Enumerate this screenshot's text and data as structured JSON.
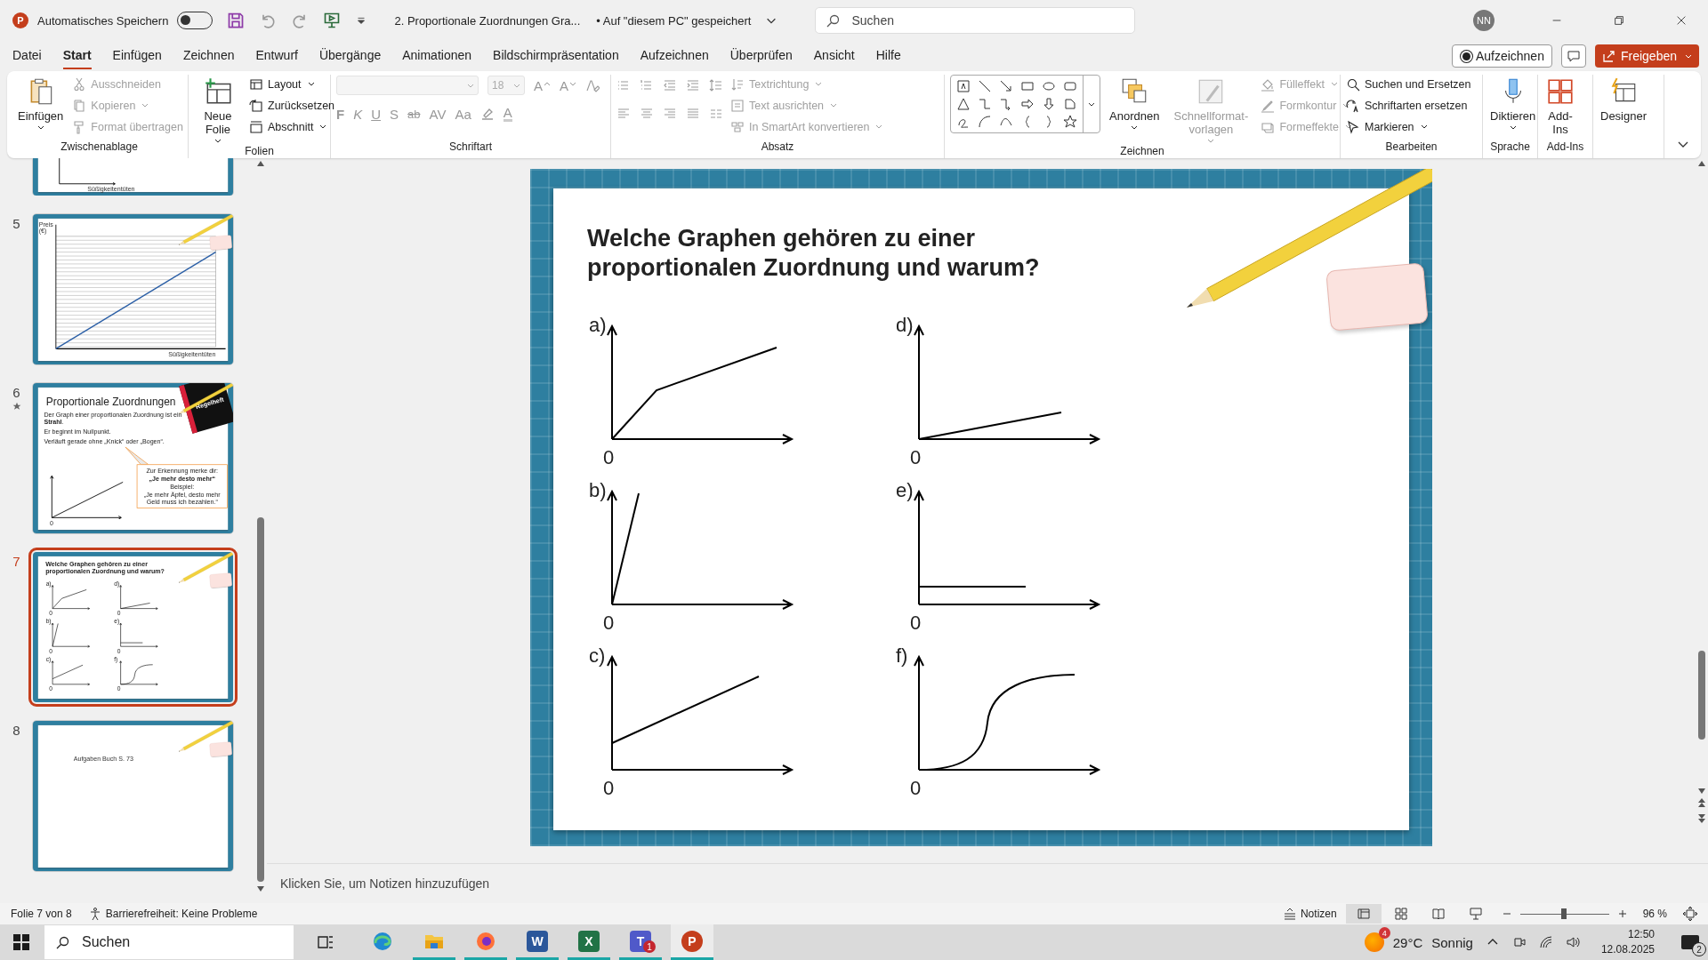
{
  "titlebar": {
    "app_letter": "P",
    "autosave": {
      "label": "Automatisches Speichern",
      "on": false
    },
    "document": "2. Proportionale Zuordnungen Gra...",
    "save_state": "• Auf \"diesem PC\" gespeichert",
    "search": {
      "placeholder": "Suchen"
    },
    "avatar": "NN"
  },
  "menu": [
    {
      "label": "Datei",
      "selected": false
    },
    {
      "label": "Start",
      "selected": true
    },
    {
      "label": "Einfügen",
      "selected": false
    },
    {
      "label": "Zeichnen",
      "selected": false
    },
    {
      "label": "Entwurf",
      "selected": false
    },
    {
      "label": "Übergänge",
      "selected": false
    },
    {
      "label": "Animationen",
      "selected": false
    },
    {
      "label": "Bildschirmpräsentation",
      "selected": false
    },
    {
      "label": "Aufzeichnen",
      "selected": false
    },
    {
      "label": "Überprüfen",
      "selected": false
    },
    {
      "label": "Ansicht",
      "selected": false
    },
    {
      "label": "Hilfe",
      "selected": false
    }
  ],
  "menu_actions": {
    "record": "Aufzeichnen",
    "share": "Freigeben"
  },
  "ribbon": {
    "clipboard": {
      "label": "Zwischenablage",
      "paste": "Einfügen",
      "items": [
        {
          "label": "Ausschneiden",
          "disabled": true
        },
        {
          "label": "Kopieren",
          "disabled": true
        },
        {
          "label": "Format übertragen",
          "disabled": true
        }
      ]
    },
    "slides": {
      "label": "Folien",
      "new_slide": "Neue Folie",
      "items": [
        {
          "label": "Layout",
          "disabled": false
        },
        {
          "label": "Zurücksetzen",
          "disabled": false
        },
        {
          "label": "Abschnitt",
          "disabled": false
        }
      ]
    },
    "font": {
      "label": "Schriftart",
      "size": "18",
      "grow": "A",
      "shrink": "A",
      "format_buttons": [
        "F",
        "K",
        "U",
        "S",
        "ab",
        "AV",
        "Aa"
      ],
      "font_color_button": "A"
    },
    "paragraph": {
      "label": "Absatz",
      "items": [
        {
          "label": "Textrichtung",
          "disabled": true
        },
        {
          "label": "Text ausrichten",
          "disabled": true
        },
        {
          "label": "In SmartArt konvertieren",
          "disabled": true
        }
      ]
    },
    "drawing": {
      "label": "Zeichnen",
      "arrange": "Anordnen",
      "quick_styles": "Schnellformat-vorlagen",
      "items": [
        {
          "label": "Fülleffekt",
          "disabled": true
        },
        {
          "label": "Formkontur",
          "disabled": true
        },
        {
          "label": "Formeffekte",
          "disabled": true
        }
      ]
    },
    "editing": {
      "label": "Bearbeiten",
      "items": [
        {
          "label": "Suchen und Ersetzen",
          "disabled": false
        },
        {
          "label": "Schriftarten ersetzen",
          "disabled": false
        },
        {
          "label": "Markieren",
          "disabled": false
        }
      ]
    },
    "voice": {
      "label": "Sprache",
      "dictate": "Diktieren"
    },
    "addins": {
      "label": "Add-Ins",
      "button": "Add-Ins"
    },
    "designer": {
      "button": "Designer"
    }
  },
  "thumbnails": [
    {
      "kind": "partial",
      "selected": false,
      "animated": false,
      "xlabel": "Süßigkeitentüten"
    },
    {
      "kind": "chart",
      "number": "5",
      "selected": false,
      "animated": false,
      "ylabel": "Preis (€)",
      "xlabel": "Süßigkeitentüten"
    },
    {
      "kind": "rule",
      "number": "6",
      "selected": false,
      "animated": true,
      "title": "Proportionale Zuordnungen",
      "book": "Regelheft",
      "lines": [
        "Der Graph einer proportionalen Zuordnung ist ein **Strahl**.",
        "Er beginnt im Nullpunkt.",
        "Verläuft gerade ohne „Knick“ oder „Bogen“."
      ],
      "callout": [
        "Zur Erkennung merke dir:",
        "**„Je mehr desto mehr“**",
        "Beispiel:",
        "„Je mehr Äpfel, desto mehr Geld muss ich bezahlen.“"
      ],
      "origin": "0"
    },
    {
      "kind": "graphs",
      "number": "7",
      "selected": true,
      "animated": false,
      "title": "Welche Graphen gehören zu einer proportionalen Zuordnung und warum?",
      "graphs": [
        {
          "label": "a)",
          "kind": "kinked",
          "origin": "0"
        },
        {
          "label": "d)",
          "kind": "shallow",
          "origin": "0"
        },
        {
          "label": "b)",
          "kind": "steep",
          "origin": "0"
        },
        {
          "label": "e)",
          "kind": "constant",
          "origin": "0"
        },
        {
          "label": "c)",
          "kind": "offset",
          "origin": "0"
        },
        {
          "label": "f)",
          "kind": "s-curve",
          "origin": "0"
        }
      ]
    },
    {
      "kind": "task",
      "number": "8",
      "selected": false,
      "animated": false,
      "text": "Aufgaben Buch S. 73"
    }
  ],
  "slide": {
    "title": "Welche Graphen gehören zu einer proportionalen Zuordnung und warum?",
    "graphs": [
      {
        "label": "a)",
        "kind": "kinked",
        "origin": "0"
      },
      {
        "label": "d)",
        "kind": "shallow",
        "origin": "0"
      },
      {
        "label": "b)",
        "kind": "steep",
        "origin": "0"
      },
      {
        "label": "e)",
        "kind": "constant",
        "origin": "0"
      },
      {
        "label": "c)",
        "kind": "offset",
        "origin": "0"
      },
      {
        "label": "f)",
        "kind": "s-curve",
        "origin": "0"
      }
    ]
  },
  "notes": {
    "placeholder": "Klicken Sie, um Notizen hinzuzufügen"
  },
  "status_bar": {
    "slide": "Folie 7 von 8",
    "accessibility": "Barrierefreiheit: Keine Probleme",
    "notes": "Notizen",
    "views": [
      {
        "selected": true
      },
      {
        "selected": false
      },
      {
        "selected": false
      },
      {
        "selected": false
      }
    ],
    "zoom": {
      "level": 0.49
    },
    "zoom_text": "96 %"
  },
  "taskbar": {
    "search": {
      "placeholder": "Suchen"
    },
    "apps": [
      {
        "running": false,
        "selected": false
      },
      {
        "running": true,
        "selected": false
      },
      {
        "running": true,
        "selected": false
      },
      {
        "letter": "W",
        "running": true,
        "selected": false
      },
      {
        "letter": "X",
        "running": true,
        "selected": false
      },
      {
        "letter": "T",
        "running": true,
        "selected": false,
        "badge": "1"
      },
      {
        "letter": "P",
        "running": true,
        "selected": true
      }
    ],
    "weather_badge": "4",
    "temperature": "29°C",
    "weather": "Sonnig",
    "time": "12:50",
    "date": "12.08.2025",
    "notifications": "2"
  }
}
